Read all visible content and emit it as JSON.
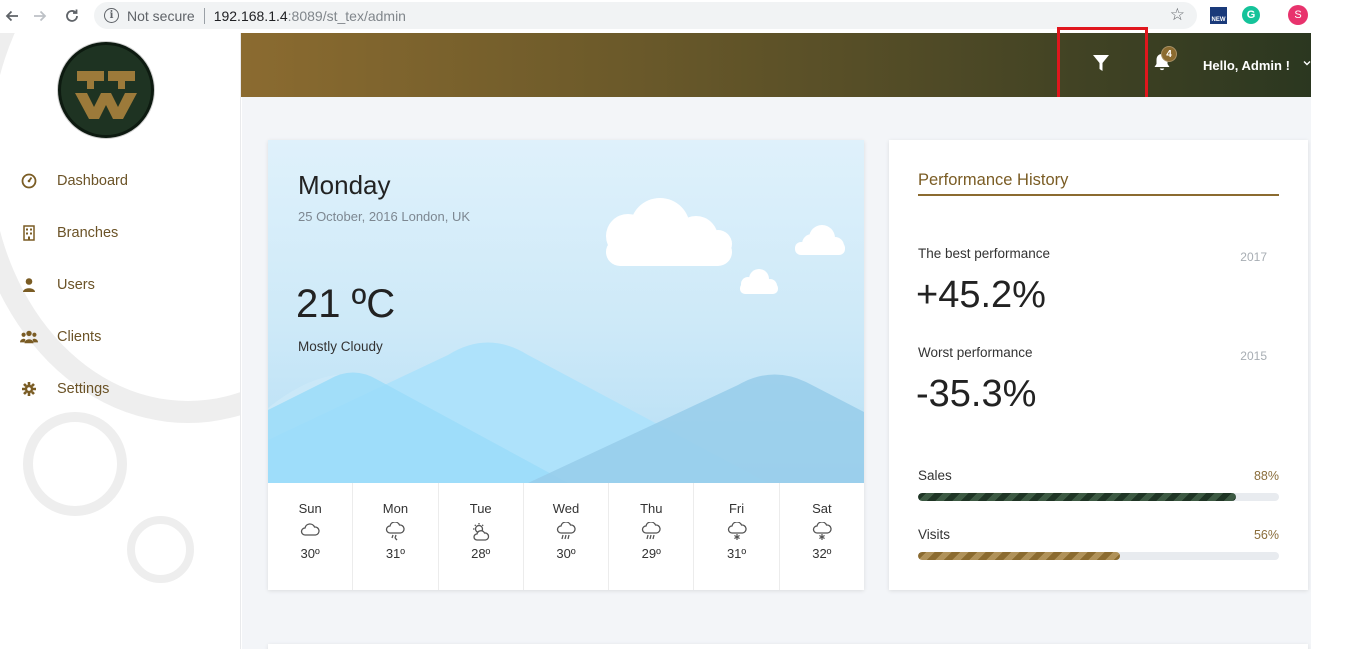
{
  "browser": {
    "security_label": "Not secure",
    "url_host": "192.168.1.4",
    "url_path": ":8089/st_tex/admin",
    "extension_new_label": "NEW",
    "extension_g_label": "G",
    "profile_initial": "S"
  },
  "sidebar": {
    "items": [
      {
        "label": "Dashboard",
        "icon": "dashboard-icon"
      },
      {
        "label": "Branches",
        "icon": "building-icon"
      },
      {
        "label": "Users",
        "icon": "user-icon"
      },
      {
        "label": "Clients",
        "icon": "users-icon"
      },
      {
        "label": "Settings",
        "icon": "gear-icon"
      }
    ]
  },
  "header": {
    "notification_count": "4",
    "greeting": "Hello, Admin !",
    "filter_icon": "filter-icon",
    "bell_icon": "bell-icon",
    "highlight_color": "#e0161d"
  },
  "weather": {
    "day": "Monday",
    "date_location": "25 October, 2016 London, UK",
    "temperature": "21 ºC",
    "condition": "Mostly Cloudy",
    "forecast": [
      {
        "day": "Sun",
        "temp": "30º",
        "icon": "cloud-icon"
      },
      {
        "day": "Mon",
        "temp": "31º",
        "icon": "cloud-rain-icon"
      },
      {
        "day": "Tue",
        "temp": "28º",
        "icon": "sun-cloud-icon"
      },
      {
        "day": "Wed",
        "temp": "30º",
        "icon": "rain-icon"
      },
      {
        "day": "Thu",
        "temp": "29º",
        "icon": "rain-icon"
      },
      {
        "day": "Fri",
        "temp": "31º",
        "icon": "snow-cloud-icon"
      },
      {
        "day": "Sat",
        "temp": "32º",
        "icon": "snow-cloud-icon"
      }
    ]
  },
  "performance": {
    "title": "Performance History",
    "best_label": "The best performance",
    "best_year": "2017",
    "best_value": "+45.2%",
    "worst_label": "Worst performance",
    "worst_year": "2015",
    "worst_value": "-35.3%",
    "sales_label": "Sales",
    "sales_pct": "88%",
    "sales_value": 88,
    "visits_label": "Visits",
    "visits_pct": "56%",
    "visits_value": 56
  },
  "colors": {
    "brand_gold": "#8b6b30",
    "brand_dark_green": "#1f3525"
  }
}
